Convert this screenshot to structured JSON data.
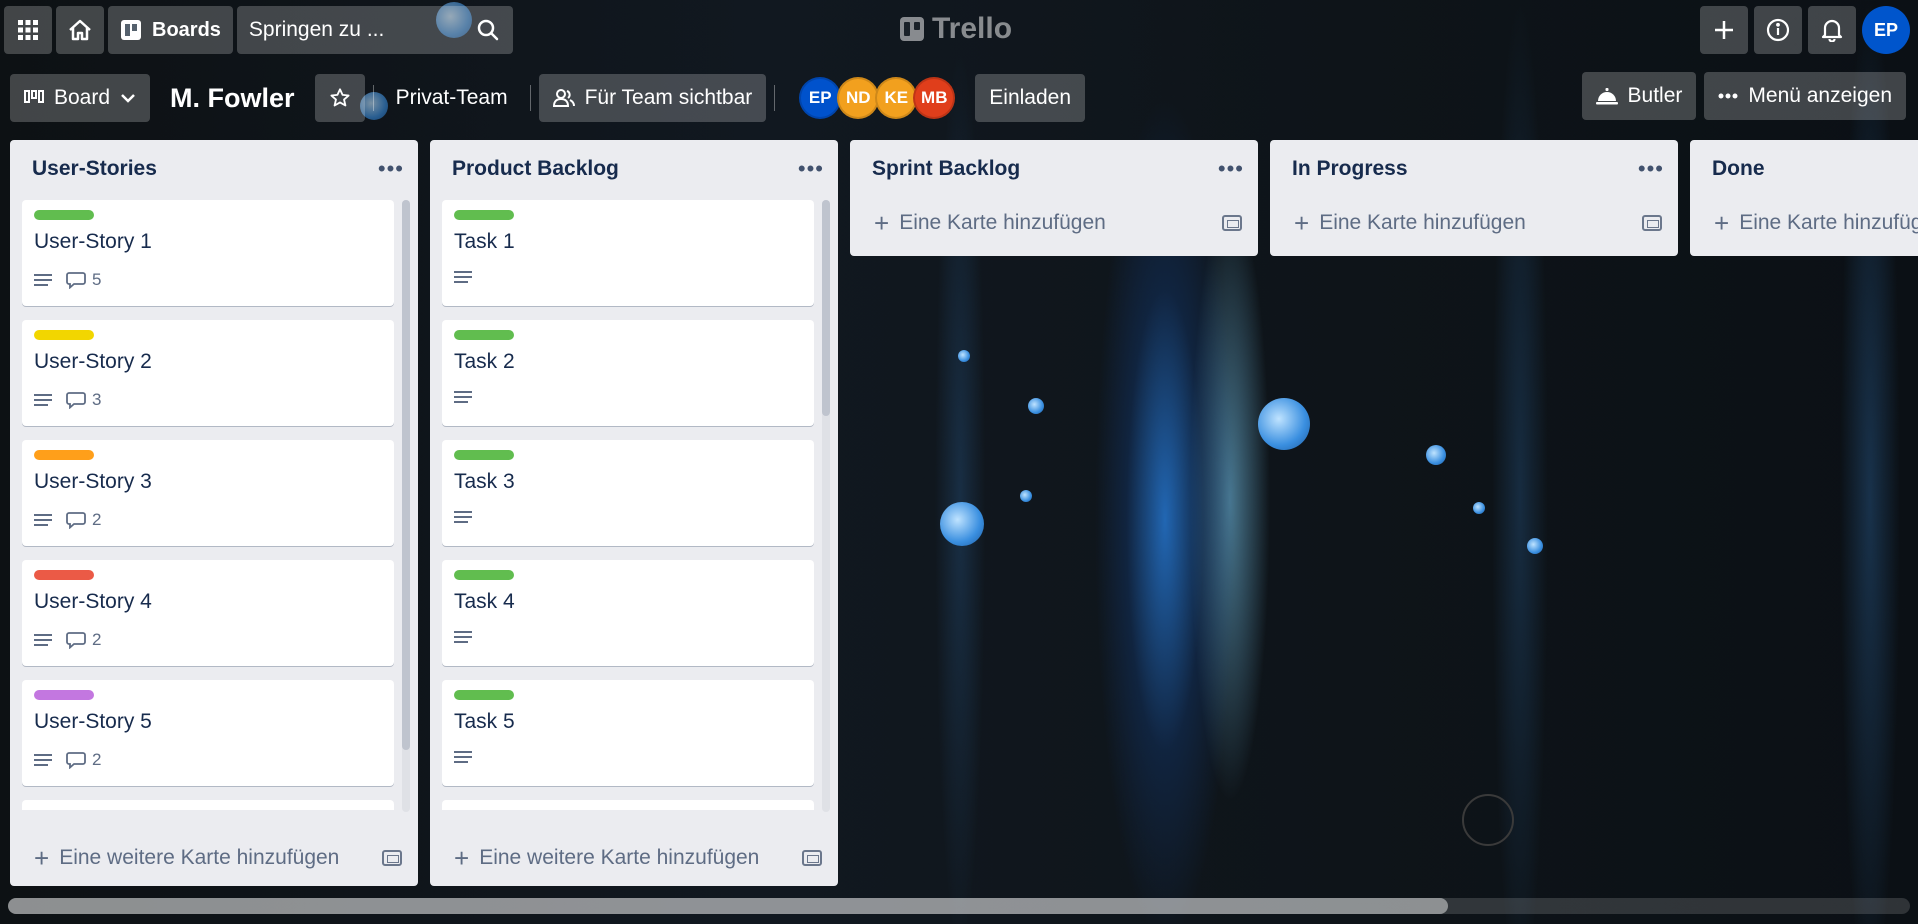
{
  "header": {
    "boards_label": "Boards",
    "search_placeholder": "Springen zu ...",
    "logo_text": "Trello",
    "user_initials": "EP",
    "icons": [
      "apps-grid-icon",
      "home-icon",
      "board-icon",
      "search-icon",
      "plus-icon",
      "info-icon",
      "bell-icon"
    ]
  },
  "board": {
    "view_label": "Board",
    "title": "M. Fowler",
    "team": "Privat-Team",
    "visibility": "Für Team sichtbar",
    "members": [
      {
        "initials": "EP",
        "color": "#0052cc"
      },
      {
        "initials": "ND",
        "color": "#f2a01e"
      },
      {
        "initials": "KE",
        "color": "#f2a01e"
      },
      {
        "initials": "MB",
        "color": "#e03e1b"
      }
    ],
    "invite_label": "Einladen",
    "butler_label": "Butler",
    "menu_label": "Menü anzeigen"
  },
  "lists": [
    {
      "title": "User-Stories",
      "add_label": "Eine weitere Karte hinzufügen",
      "cards": [
        {
          "title": "User-Story 1",
          "label_color": "#61bd4f",
          "comments": "5"
        },
        {
          "title": "User-Story 2",
          "label_color": "#f2d600",
          "comments": "3"
        },
        {
          "title": "User-Story 3",
          "label_color": "#ff9f1a",
          "comments": "2"
        },
        {
          "title": "User-Story 4",
          "label_color": "#eb5a46",
          "comments": "2"
        },
        {
          "title": "User-Story 5",
          "label_color": "#c377e0",
          "comments": "2"
        },
        {
          "title": "",
          "label_color": "#0079bf",
          "comments": ""
        }
      ]
    },
    {
      "title": "Product Backlog",
      "add_label": "Eine weitere Karte hinzufügen",
      "cards": [
        {
          "title": "Task 1",
          "label_color": "#61bd4f"
        },
        {
          "title": "Task 2",
          "label_color": "#61bd4f"
        },
        {
          "title": "Task 3",
          "label_color": "#61bd4f"
        },
        {
          "title": "Task 4",
          "label_color": "#61bd4f"
        },
        {
          "title": "Task 5",
          "label_color": "#61bd4f"
        },
        {
          "title": "",
          "label_color": "#f2d600"
        }
      ]
    },
    {
      "title": "Sprint Backlog",
      "add_label": "Eine Karte hinzufügen"
    },
    {
      "title": "In Progress",
      "add_label": "Eine Karte hinzufügen"
    },
    {
      "title": "Done",
      "add_label": "Eine Karte hinzufügen"
    }
  ]
}
